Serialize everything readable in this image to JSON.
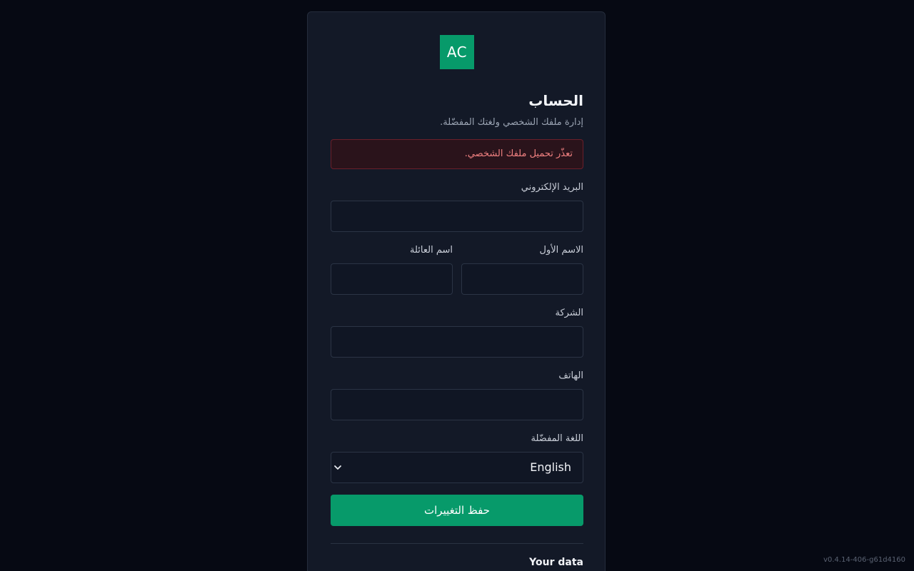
{
  "logo": {
    "text": "AC",
    "color": "#079a6a"
  },
  "page": {
    "title": "الحساب",
    "subtitle": "إدارة ملفك الشخصي ولغتك المفضّلة."
  },
  "error": {
    "message": "تعذّر تحميل ملفك الشخصي."
  },
  "form": {
    "email": {
      "label": "البريد الإلكتروني",
      "value": ""
    },
    "first_name": {
      "label": "الاسم الأول",
      "value": ""
    },
    "last_name": {
      "label": "اسم العائلة",
      "value": ""
    },
    "company": {
      "label": "الشركة",
      "value": ""
    },
    "phone": {
      "label": "الهاتف",
      "value": ""
    },
    "language": {
      "label": "اللغة المفضّلة",
      "selected": "English",
      "icon": "chevron-down-icon"
    },
    "save_label": "حفظ التغييرات"
  },
  "data_section": {
    "title": "Your data"
  },
  "footer": {
    "version": "v0.4.14-406-g61d4160"
  },
  "colors": {
    "background": "#060913",
    "card": "#131927",
    "accent": "#079a6a",
    "error_text": "#f08080",
    "error_bg": "#2a131b"
  }
}
